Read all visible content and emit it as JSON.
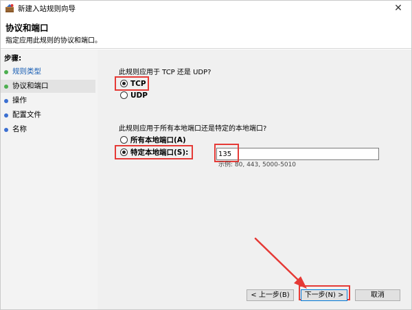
{
  "window": {
    "title": "新建入站规则向导",
    "close_glyph": "✕"
  },
  "header": {
    "title": "协议和端口",
    "subtitle": "指定应用此规则的协议和端口。"
  },
  "sidebar": {
    "steps_title": "步骤:",
    "items": [
      {
        "label": "规则类型",
        "dot_color": "#4caf50",
        "text_color": "#1a5fb4"
      },
      {
        "label": "协议和端口",
        "dot_color": "#4caf50",
        "text_color": "#000000"
      },
      {
        "label": "操作",
        "dot_color": "#3b6fd1",
        "text_color": "#000000"
      },
      {
        "label": "配置文件",
        "dot_color": "#3b6fd1",
        "text_color": "#000000"
      },
      {
        "label": "名称",
        "dot_color": "#3b6fd1",
        "text_color": "#000000"
      }
    ]
  },
  "protocol": {
    "question": "此规则应用于 TCP 还是 UDP?",
    "options": [
      {
        "label": "TCP",
        "selected": true
      },
      {
        "label": "UDP",
        "selected": false
      }
    ]
  },
  "ports": {
    "question": "此规则应用于所有本地端口还是特定的本地端口?",
    "options": [
      {
        "label": "所有本地端口(A)",
        "selected": false
      },
      {
        "label": "特定本地端口(S):",
        "selected": true
      }
    ],
    "value": "135",
    "example": "示例: 80, 443, 5000-5010"
  },
  "buttons": {
    "back": "< 上一步(B)",
    "next": "下一步(N) >",
    "cancel": "取消"
  },
  "colors": {
    "highlight": "#e53935",
    "accent": "#0078d7"
  }
}
